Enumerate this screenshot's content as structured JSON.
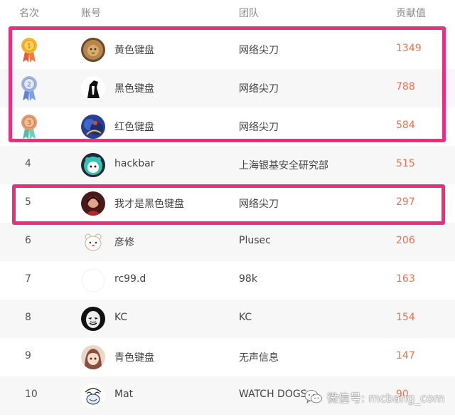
{
  "header": {
    "rank": "名次",
    "account": "账号",
    "team": "团队",
    "score": "贡献值"
  },
  "rows": [
    {
      "rank": "",
      "medal": "gold-medal-icon",
      "avatar": "lion-avatar",
      "name": "黄色键盘",
      "team": "网络尖刀",
      "score": "1349"
    },
    {
      "rank": "",
      "medal": "silver-medal-icon",
      "avatar": "black-figure-avatar",
      "name": "黑色键盘",
      "team": "网络尖刀",
      "score": "788"
    },
    {
      "rank": "",
      "medal": "bronze-medal-icon",
      "avatar": "blue-anime-avatar",
      "name": "红色键盘",
      "team": "网络尖刀",
      "score": "584"
    },
    {
      "rank": "4",
      "avatar": "teal-cartoon-avatar",
      "name": "hackbar",
      "team": "上海银基安全研究部",
      "score": "515"
    },
    {
      "rank": "5",
      "avatar": "red-portrait-avatar",
      "name": "我才是黑色键盘",
      "team": "网络尖刀",
      "score": "297"
    },
    {
      "rank": "6",
      "avatar": "white-bear-avatar",
      "name": "彦修",
      "team": "Plusec",
      "score": "206"
    },
    {
      "rank": "7",
      "avatar": "blank-avatar",
      "name": "rc99.d",
      "team": "98k",
      "score": "163"
    },
    {
      "rank": "8",
      "avatar": "anonymous-mask-avatar",
      "name": "KC",
      "team": "KC",
      "score": "154"
    },
    {
      "rank": "9",
      "avatar": "anime-girl-avatar",
      "name": "青色键盘",
      "team": "无声信息",
      "score": "147"
    },
    {
      "rank": "10",
      "avatar": "sketch-avatar",
      "name": "Mat",
      "team": "WATCH DOGS",
      "score": "90"
    }
  ],
  "medal_labels": [
    "1",
    "2",
    "3"
  ],
  "watermark": {
    "icon": "wechat-icon",
    "text": "微信号: mcbang_com"
  },
  "colors": {
    "score": "#f0714d",
    "highlight": "#ea2f81",
    "row_alt": "#f7f7f7",
    "gold": "#f5b52a",
    "silver": "#9fb3d9",
    "bronze": "#e19b6c"
  }
}
